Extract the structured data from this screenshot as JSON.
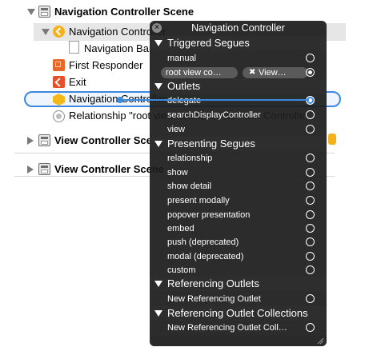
{
  "outline": {
    "scene_title": "Navigation Controller Scene",
    "nav_controller": "Navigation Controller",
    "nav_bar": "Navigation Bar",
    "first_responder": "First Responder",
    "exit": "Exit",
    "nav_controller_selected": "Navigation Controller",
    "relationship": "Relationship \"root view controller\" to View Controller",
    "view_controller_scene_1": "View Controller Scene",
    "view_controller_scene_2": "View Controller Scene"
  },
  "hud": {
    "title": "Navigation Controller",
    "sections": {
      "triggered_segues": "Triggered Segues",
      "outlets": "Outlets",
      "presenting_segues": "Presenting Segues",
      "referencing_outlets": "Referencing Outlets",
      "referencing_outlet_collections": "Referencing Outlet Collections"
    },
    "triggered": {
      "manual": "manual",
      "root_view_pill": "root view co…",
      "view_pill": "View…",
      "close_glyph": "✖"
    },
    "outlets": {
      "delegate": "delegate",
      "search": "searchDisplayController",
      "view": "view"
    },
    "presenting": [
      "relationship",
      "show",
      "show detail",
      "present modally",
      "popover presentation",
      "embed",
      "push (deprecated)",
      "modal (deprecated)",
      "custom"
    ],
    "referencing_outlets": {
      "new": "New Referencing Outlet"
    },
    "referencing_outlet_collections": {
      "new": "New Referencing Outlet Coll…"
    }
  }
}
